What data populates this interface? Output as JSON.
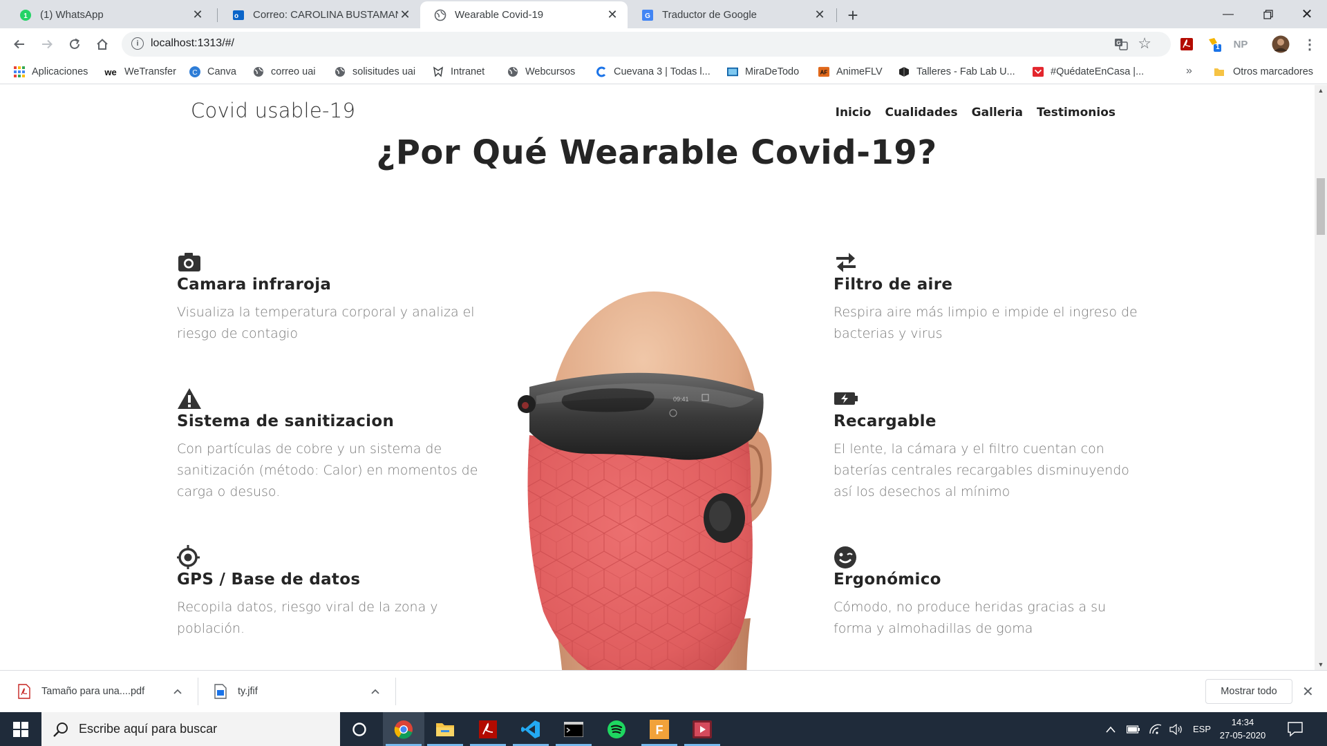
{
  "browser": {
    "tabs": [
      {
        "title": "(1) WhatsApp",
        "icon": "whatsapp-icon",
        "active": false
      },
      {
        "title": "Correo: CAROLINA BUSTAMANTE",
        "icon": "outlook-icon",
        "active": false
      },
      {
        "title": "Wearable Covid-19",
        "icon": "globe-icon",
        "active": true
      },
      {
        "title": "Traductor de Google",
        "icon": "google-translate-icon",
        "active": false
      }
    ],
    "url": "localhost:1313/#/",
    "extension_np_label": "NP",
    "extension_badge": "1"
  },
  "bookmarks": [
    {
      "label": "Aplicaciones",
      "icon": "apps-grid-icon"
    },
    {
      "label": "WeTransfer",
      "icon": "wetransfer-icon"
    },
    {
      "label": "Canva",
      "icon": "canva-icon"
    },
    {
      "label": "correo uai",
      "icon": "globe-icon"
    },
    {
      "label": "solisitudes uai",
      "icon": "globe-icon"
    },
    {
      "label": "Intranet",
      "icon": "intranet-icon"
    },
    {
      "label": "Webcursos",
      "icon": "globe-icon"
    },
    {
      "label": "Cuevana 3 | Todas l...",
      "icon": "cuevana-icon"
    },
    {
      "label": "MiraDeTodo",
      "icon": "miradetodo-icon"
    },
    {
      "label": "AnimeFLV",
      "icon": "animeflv-icon"
    },
    {
      "label": "Talleres - Fab Lab U...",
      "icon": "fablab-icon"
    },
    {
      "label": "#QuédateEnCasa |...",
      "icon": "quedate-icon"
    }
  ],
  "bookmarks_more": "»",
  "bookmarks_other": "Otros marcadores",
  "site": {
    "brand": "Covid usable-19",
    "nav": [
      "Inicio",
      "Cualidades",
      "Galleria",
      "Testimonios"
    ],
    "title": "¿Por Qué Wearable Covid-19?",
    "features_left": [
      {
        "icon": "camera-icon",
        "title": "Camara infraroja",
        "text": "Visualiza la temperatura corporal y analiza el riesgo de contagio"
      },
      {
        "icon": "warning-icon",
        "title": "Sistema de sanitizacion",
        "text": "Con partículas de cobre y un sistema de sanitización (método: Calor) en momentos de carga o desuso."
      },
      {
        "icon": "crosshair-icon",
        "title": "GPS / Base de datos",
        "text": "Recopila datos, riesgo viral de la zona y población."
      }
    ],
    "features_right": [
      {
        "icon": "exchange-icon",
        "title": "Filtro de aire",
        "text": "Respira aire más limpio e impide el ingreso de bacterias y virus"
      },
      {
        "icon": "battery-charging-icon",
        "title": "Recargable",
        "text": "El lente, la cámara y el filtro cuentan con baterías centrales recargables disminuyendo así los desechos al mínimo"
      },
      {
        "icon": "smile-wink-icon",
        "title": "Ergonómico",
        "text": "Cómodo, no produce heridas gracias a su forma y almohadillas de goma"
      }
    ],
    "mask_screen_time": "09:41"
  },
  "downloads": {
    "items": [
      {
        "name": "Tamaño para una....pdf",
        "icon": "pdf-file-icon"
      },
      {
        "name": "ty.jfif",
        "icon": "image-file-icon"
      }
    ],
    "show_all": "Mostrar todo"
  },
  "taskbar": {
    "search_placeholder": "Escribe aquí para buscar",
    "language": "ESP",
    "time": "14:34",
    "date": "27-05-2020"
  },
  "colors": {
    "tabstrip": "#dee1e6",
    "mask": "#e2605f",
    "taskbar": "#1f2b3a",
    "heading": "#252525",
    "body_text": "#777777"
  }
}
